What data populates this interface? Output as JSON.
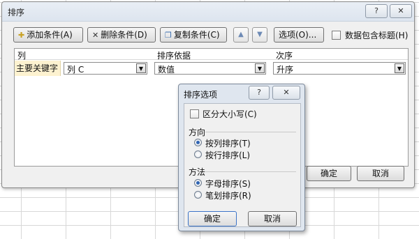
{
  "dialog": {
    "title": "排序",
    "help_label": "?",
    "close_label": "✕",
    "add_condition": "添加条件(A)",
    "delete_condition": "删除条件(D)",
    "copy_condition": "复制条件(C)",
    "options": "选项(O)...",
    "header_checkbox_label": "数据包含标题(H)",
    "header_checkbox_checked": false,
    "ok": "确定",
    "cancel": "取消"
  },
  "grid": {
    "headers": [
      "列",
      "排序依据",
      "次序"
    ],
    "row": {
      "label": "主要关键字",
      "column": "列 C",
      "sort_on": "数值",
      "order": "升序"
    }
  },
  "options_dialog": {
    "title": "排序选项",
    "help_label": "?",
    "close_label": "✕",
    "case_sensitive_label": "区分大小写(C)",
    "case_sensitive_checked": false,
    "direction_label": "方向",
    "direction_options": [
      "按列排序(T)",
      "按行排序(L)"
    ],
    "direction_selected": 0,
    "method_label": "方法",
    "method_options": [
      "字母排序(S)",
      "笔划排序(R)"
    ],
    "method_selected": 0,
    "ok": "确定",
    "cancel": "取消"
  }
}
